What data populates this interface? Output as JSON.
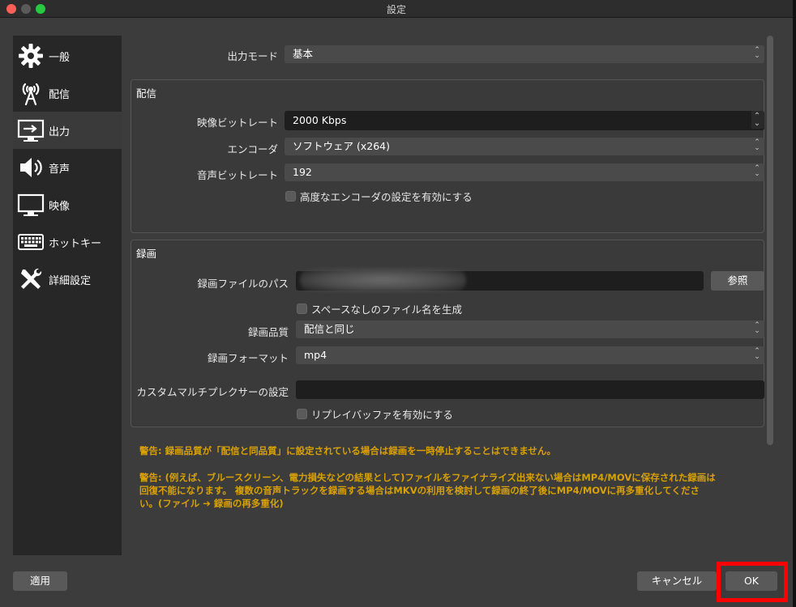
{
  "window": {
    "title": "設定"
  },
  "sidebar": {
    "items": [
      {
        "label": "一般",
        "icon": "gear-icon"
      },
      {
        "label": "配信",
        "icon": "antenna-icon"
      },
      {
        "label": "出力",
        "icon": "output-monitor-icon"
      },
      {
        "label": "音声",
        "icon": "speaker-icon"
      },
      {
        "label": "映像",
        "icon": "monitor-icon"
      },
      {
        "label": "ホットキー",
        "icon": "keyboard-icon"
      },
      {
        "label": "詳細設定",
        "icon": "tools-icon"
      }
    ],
    "active_index": 2
  },
  "output_mode": {
    "label": "出力モード",
    "value": "基本"
  },
  "streaming": {
    "title": "配信",
    "video_bitrate": {
      "label": "映像ビットレート",
      "value": "2000 Kbps"
    },
    "encoder": {
      "label": "エンコーダ",
      "value": "ソフトウェア (x264)"
    },
    "audio_bitrate": {
      "label": "音声ビットレート",
      "value": "192"
    },
    "advanced_encoder": {
      "label": "高度なエンコーダの設定を有効にする",
      "checked": false
    }
  },
  "recording": {
    "title": "録画",
    "path": {
      "label": "録画ファイルのパス",
      "value": "",
      "browse_label": "参照"
    },
    "no_space": {
      "label": "スペースなしのファイル名を生成",
      "checked": false
    },
    "quality": {
      "label": "録画品質",
      "value": "配信と同じ"
    },
    "format": {
      "label": "録画フォーマット",
      "value": "mp4"
    },
    "muxer": {
      "label": "カスタムマルチプレクサーの設定",
      "value": ""
    },
    "replay_buffer": {
      "label": "リプレイバッファを有効にする",
      "checked": false
    }
  },
  "warnings": {
    "w1": "警告: 録画品質が「配信と同品質」に設定されている場合は録画を一時停止することはできません。",
    "w2_line1": "警告: (例えば、ブルースクリーン、電力損失などの結果として)ファイルをファイナライズ出来ない場合はMP4/MOVに保存された録画は",
    "w2_line2": "回復不能になります。 複数の音声トラックを録画する場合はMKVの利用を検討して録画の終了後にMP4/MOVに再多重化してくださ",
    "w2_line3": "い。(ファイル ➔ 録画の再多重化)"
  },
  "buttons": {
    "apply": "適用",
    "cancel": "キャンセル",
    "ok": "OK"
  },
  "colors": {
    "warning": "#d8a000",
    "highlight": "#ff0000"
  }
}
